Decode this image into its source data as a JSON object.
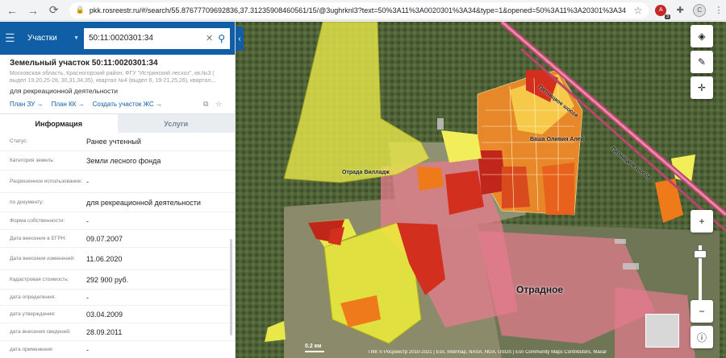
{
  "browser": {
    "url": "pkk.rosreestr.ru/#/search/55.87677709692836,37.31235908460561/15/@3ughrknl3?text=50%3A11%3A0020301%3A34&type=1&opened=50%3A11%3A20301%3A34",
    "ext_badge": "3",
    "avatar_letter": "C"
  },
  "search": {
    "type_label": "Участки",
    "value": "50:11:0020301:34"
  },
  "parcel": {
    "title": "Земельный участок 50:11:0020301:34",
    "address": "Московская область, Красногорский район, ФГУ \"Истринский лесхоз\", кв.№3 ( выдел 19,20,25-28, 30,31,34,35), квартал №4 (выдел 6, 19-21,25,26), квартал...",
    "purpose": "для рекреационной деятельности",
    "links": [
      "План ЗУ →",
      "План КК →",
      "Создать участок ЖС →"
    ]
  },
  "tabs": {
    "info": "Информация",
    "services": "Услуги"
  },
  "rows": [
    {
      "label": "Статус:",
      "value": "Ранее учтенный"
    },
    {
      "label": "Категория земель:",
      "value": "Земли лесного фонда"
    },
    {
      "label": "Разрешенное использование:",
      "value": "-"
    },
    {
      "label": "по документу:",
      "value": "для рекреационной деятельности"
    },
    {
      "label": "Форма собственности:",
      "value": "-"
    },
    {
      "label": "Дата внесения в ЕГРН:",
      "value": "09.07.2007"
    },
    {
      "label": "Дата внесения изменений:",
      "value": "11.06.2020"
    },
    {
      "label": "Кадастровая стоимость:",
      "value": "292 900 руб."
    },
    {
      "label": "дата определения:",
      "value": "-"
    },
    {
      "label": "дата утверждения:",
      "value": "03.04.2009"
    },
    {
      "label": "дата внесения сведений:",
      "value": "28.09.2011"
    },
    {
      "label": "дата применения:",
      "value": "-"
    }
  ],
  "map": {
    "town": "Отрадное",
    "road_label_1": "Пятницкое шоссе",
    "road_label_2": "Пятницкое шоссе",
    "street_label": "Отрада Вилладж",
    "street_label_2": "Ваша Оливия Алей",
    "scale": "0.2 км",
    "attribution": "ПКК © Росреестр 2010-2021 | Esri, Intermap, NASA, NGA, USGS | Esri Community Maps Contributors, Maxar"
  },
  "colors": {
    "header_blue": "#0f5ea6",
    "parcel_yellow": "#e8e84a",
    "parcel_red": "#d32f1f",
    "parcel_orange": "#ef7a1a"
  }
}
